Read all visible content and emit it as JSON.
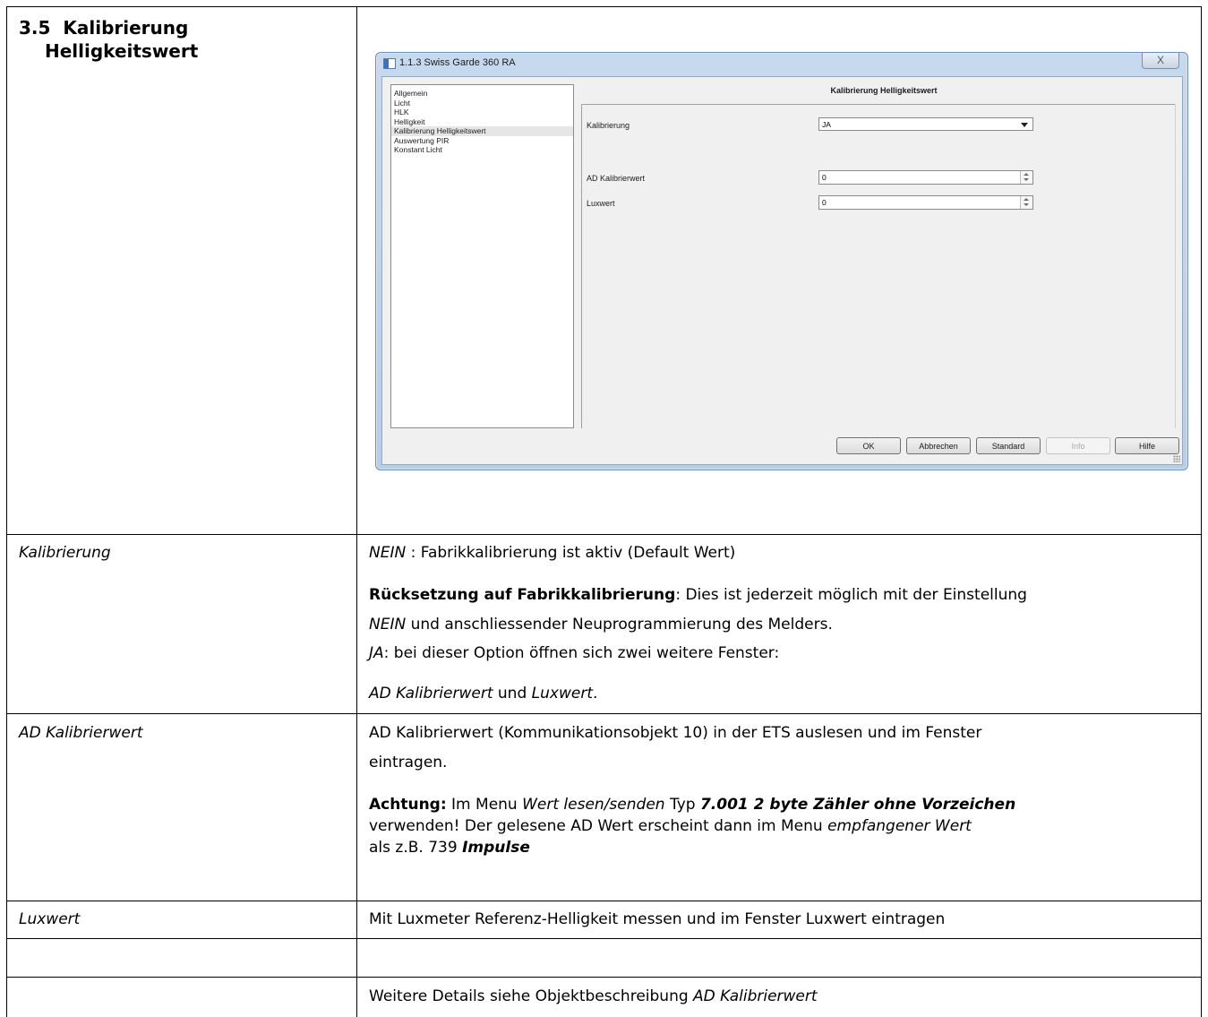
{
  "document": {
    "section_number": "3.5",
    "section_title_line1": "Kalibrierung",
    "section_title_line2": "Helligkeitswert"
  },
  "dialog": {
    "window_title": "1.1.3 Swiss Garde 360 RA",
    "close_glyph": "X",
    "nav_items": [
      {
        "label": "Allgemein",
        "selected": false
      },
      {
        "label": "Licht",
        "selected": false
      },
      {
        "label": "HLK",
        "selected": false
      },
      {
        "label": "Helligkeit",
        "selected": false
      },
      {
        "label": "Kalibrierung Helligkeitswert",
        "selected": true
      },
      {
        "label": "Auswertung PIR",
        "selected": false
      },
      {
        "label": "Konstant Licht",
        "selected": false
      }
    ],
    "pane_title": "Kalibrierung Helligkeitswert",
    "fields": {
      "kalibrierung": {
        "label": "Kalibrierung",
        "value": "JA"
      },
      "ad_kalibrierwert": {
        "label": "AD Kalibrierwert",
        "value": "0"
      },
      "luxwert": {
        "label": "Luxwert",
        "value": "0"
      }
    },
    "buttons": {
      "ok": "OK",
      "cancel": "Abbrechen",
      "default": "Standard",
      "info": "Info",
      "help": "Hilfe"
    }
  },
  "rows": {
    "kalibrierung": {
      "name": "Kalibrierung",
      "nein": "NEIN",
      "nein_desc": " : Fabrikkalibrierung ist aktiv (Default Wert)",
      "reset_bold": "Rücksetzung auf Fabrikkalibrierung",
      "reset_desc": ": Dies ist jederzeit möglich mit der Einstellung",
      "nein2": "NEIN",
      "reset_desc2": " und anschliessender Neuprogrammierung des Melders.",
      "ja": "JA",
      "ja_desc": ": bei dieser Option öffnen sich zwei weitere Fenster:",
      "ad_ref": "AD Kalibrierwert",
      "und": " und ",
      "lux_ref": "Luxwert",
      "period": "."
    },
    "ad": {
      "name": "AD Kalibrierwert",
      "text_line1": "AD Kalibrierwert (Kommunikationsobjekt 10) in der ETS auslesen und im Fenster",
      "text_line2": "eintragen.",
      "achtung": "Achtung:",
      "menu_intro": " Im Menu  ",
      "menu_name": "Wert lesen/senden",
      "typ": "  Typ  ",
      "type_bold": "7.001 2 byte Zähler ohne Vorzeichen",
      "line2a": "verwenden! Der gelesene AD Wert erscheint dann im Menu ",
      "line2_it": "empfangener Wert",
      "line3a": "als  z.B.  739  ",
      "line3_bold": "Impulse"
    },
    "lux": {
      "name": "Luxwert",
      "text": "Mit Luxmeter Referenz-Helligkeit messen und im Fenster Luxwert  eintragen"
    },
    "details": {
      "text": "Weitere Details siehe Objektbeschreibung  ",
      "ref": "AD Kalibrierwert"
    }
  }
}
